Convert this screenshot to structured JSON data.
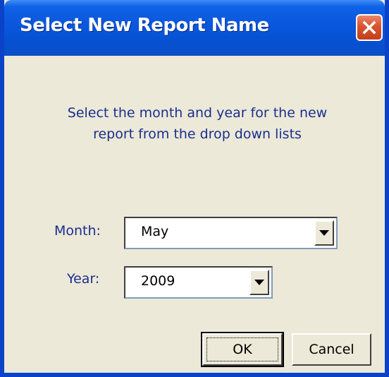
{
  "window": {
    "title": "Select New Report Name"
  },
  "dialog": {
    "instruction_line1": "Select the month and year for the new",
    "instruction_line2": "report from the drop down lists",
    "month": {
      "label": "Month:",
      "selected": "May"
    },
    "year": {
      "label": "Year:",
      "selected": "2009"
    }
  },
  "buttons": {
    "ok": "OK",
    "cancel": "Cancel"
  },
  "icons": {
    "close": "close-icon",
    "dropdown": "chevron-down-icon"
  },
  "colors": {
    "titlebar": "#0a58dd",
    "dialog_bg": "#ece9d8",
    "text": "#1a2f8e",
    "close_button": "#d9532f"
  }
}
